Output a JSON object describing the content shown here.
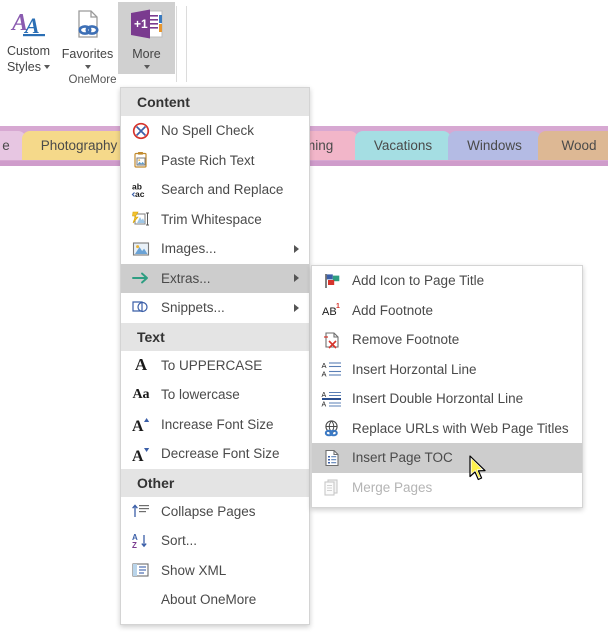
{
  "ribbon": {
    "group_label": "OneMore",
    "buttons": [
      {
        "label_line1": "Custom",
        "label_line2": "Styles",
        "icon": "custom-styles-icon",
        "has_caret": true,
        "selected": false
      },
      {
        "label_line1": "Favorites",
        "label_line2": "",
        "icon": "favorites-icon",
        "has_caret": true,
        "selected": false
      },
      {
        "label_line1": "More",
        "label_line2": "",
        "icon": "more-onenote-icon",
        "has_caret": true,
        "selected": true
      }
    ]
  },
  "tabs": [
    {
      "label": "e",
      "color": "#e7c6e2"
    },
    {
      "label": "Photography",
      "color": "#f5d98a"
    },
    {
      "label": "mming",
      "color": "#f2b6c9"
    },
    {
      "label": "Vacations",
      "color": "#a5dee3"
    },
    {
      "label": "Windows",
      "color": "#b4bbe4"
    },
    {
      "label": "Wood",
      "color": "#ddb894"
    }
  ],
  "tabstrip": {
    "background": "#d7a8d2"
  },
  "main_menu": {
    "sections": [
      {
        "header": "Content",
        "items": [
          {
            "label": "No Spell Check",
            "icon": "no-spell-check-icon",
            "submenu": false,
            "highlighted": false,
            "disabled": false
          },
          {
            "label": "Paste Rich Text",
            "icon": "paste-rich-text-icon",
            "submenu": false,
            "highlighted": false,
            "disabled": false
          },
          {
            "label": "Search and Replace",
            "icon": "search-replace-icon",
            "submenu": false,
            "highlighted": false,
            "disabled": false
          },
          {
            "label": "Trim Whitespace",
            "icon": "trim-whitespace-icon",
            "submenu": false,
            "highlighted": false,
            "disabled": false
          },
          {
            "label": "Images...",
            "icon": "images-icon",
            "submenu": true,
            "highlighted": false,
            "disabled": false
          },
          {
            "label": "Extras...",
            "icon": "extras-arrow-icon",
            "submenu": true,
            "highlighted": true,
            "disabled": false
          },
          {
            "label": "Snippets...",
            "icon": "snippets-icon",
            "submenu": true,
            "highlighted": false,
            "disabled": false
          }
        ]
      },
      {
        "header": "Text",
        "items": [
          {
            "label": "To UPPERCASE",
            "icon": "uppercase-icon",
            "submenu": false,
            "highlighted": false,
            "disabled": false
          },
          {
            "label": "To lowercase",
            "icon": "lowercase-icon",
            "submenu": false,
            "highlighted": false,
            "disabled": false
          },
          {
            "label": "Increase Font Size",
            "icon": "increase-font-size-icon",
            "submenu": false,
            "highlighted": false,
            "disabled": false
          },
          {
            "label": "Decrease Font Size",
            "icon": "decrease-font-size-icon",
            "submenu": false,
            "highlighted": false,
            "disabled": false
          }
        ]
      },
      {
        "header": "Other",
        "items": [
          {
            "label": "Collapse Pages",
            "icon": "collapse-pages-icon",
            "submenu": false,
            "highlighted": false,
            "disabled": false
          },
          {
            "label": "Sort...",
            "icon": "sort-az-icon",
            "submenu": false,
            "highlighted": false,
            "disabled": false
          },
          {
            "label": "Show XML",
            "icon": "show-xml-icon",
            "submenu": false,
            "highlighted": false,
            "disabled": false
          },
          {
            "label": "About OneMore",
            "icon": "none",
            "submenu": false,
            "highlighted": false,
            "disabled": false
          }
        ]
      }
    ]
  },
  "sub_menu": {
    "items": [
      {
        "label": "Add Icon to Page Title",
        "icon": "add-icon-to-page-title-icon",
        "highlighted": false,
        "disabled": false
      },
      {
        "label": "Add Footnote",
        "icon": "add-footnote-icon",
        "highlighted": false,
        "disabled": false
      },
      {
        "label": "Remove Footnote",
        "icon": "remove-footnote-icon",
        "highlighted": false,
        "disabled": false
      },
      {
        "label": "Insert Horzontal Line",
        "icon": "insert-horizontal-line-icon",
        "highlighted": false,
        "disabled": false
      },
      {
        "label": "Insert Double Horzontal Line",
        "icon": "insert-double-horizontal-line-icon",
        "highlighted": false,
        "disabled": false
      },
      {
        "label": "Replace URLs with Web Page Titles",
        "icon": "replace-urls-icon",
        "highlighted": false,
        "disabled": false
      },
      {
        "label": "Insert Page TOC",
        "icon": "insert-page-toc-icon",
        "highlighted": true,
        "disabled": false
      },
      {
        "label": "Merge Pages",
        "icon": "merge-pages-icon",
        "highlighted": false,
        "disabled": true
      }
    ]
  },
  "colors": {
    "highlight": "#cdcdcd",
    "section_header_bg": "#e4e4e4",
    "ribbon_selected_bg": "#d0d0d0",
    "accent_purple": "#7a3b8f"
  },
  "cursor": {
    "type": "arrow-pointer"
  }
}
